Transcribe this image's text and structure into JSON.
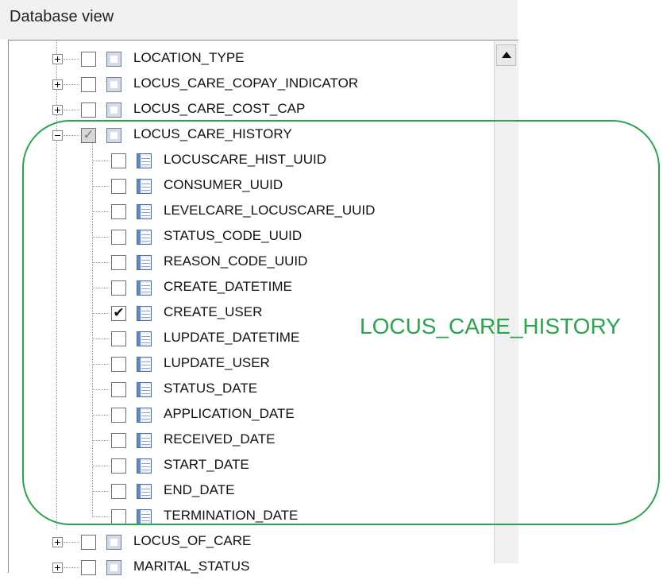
{
  "window": {
    "title": "Database view"
  },
  "tree": {
    "top_tables": [
      {
        "name": "LOCATION_TYPE",
        "checked": false,
        "expanded": false
      },
      {
        "name": "LOCUS_CARE_COPAY_INDICATOR",
        "checked": false,
        "expanded": false
      },
      {
        "name": "LOCUS_CARE_COST_CAP",
        "checked": false,
        "expanded": false
      },
      {
        "name": "LOCUS_CARE_HISTORY",
        "checked": "partial",
        "expanded": true
      }
    ],
    "columns": [
      {
        "name": "LOCUSCARE_HIST_UUID",
        "checked": false
      },
      {
        "name": "CONSUMER_UUID",
        "checked": false
      },
      {
        "name": "LEVELCARE_LOCUSCARE_UUID",
        "checked": false
      },
      {
        "name": "STATUS_CODE_UUID",
        "checked": false
      },
      {
        "name": "REASON_CODE_UUID",
        "checked": false
      },
      {
        "name": "CREATE_DATETIME",
        "checked": false
      },
      {
        "name": "CREATE_USER",
        "checked": true
      },
      {
        "name": "LUPDATE_DATETIME",
        "checked": false
      },
      {
        "name": "LUPDATE_USER",
        "checked": false
      },
      {
        "name": "STATUS_DATE",
        "checked": false
      },
      {
        "name": "APPLICATION_DATE",
        "checked": false
      },
      {
        "name": "RECEIVED_DATE",
        "checked": false
      },
      {
        "name": "START_DATE",
        "checked": false
      },
      {
        "name": "END_DATE",
        "checked": false
      },
      {
        "name": "TERMINATION_DATE",
        "checked": false
      }
    ],
    "bottom_tables": [
      {
        "name": "LOCUS_OF_CARE",
        "checked": false,
        "expanded": false
      },
      {
        "name": "MARITAL_STATUS",
        "checked": false,
        "expanded": false
      }
    ]
  },
  "annotation": {
    "label": "LOCUS_CARE_HISTORY",
    "color": "#2aa54f"
  },
  "colors": {
    "header_background": "#f1f1f1",
    "tree_line": "#9b9b9b"
  },
  "icons": {
    "table": "table-icon",
    "column": "column-icon",
    "expand": "plus-icon",
    "collapse": "minus-icon",
    "scroll": "scroll-up-arrow-icon"
  }
}
